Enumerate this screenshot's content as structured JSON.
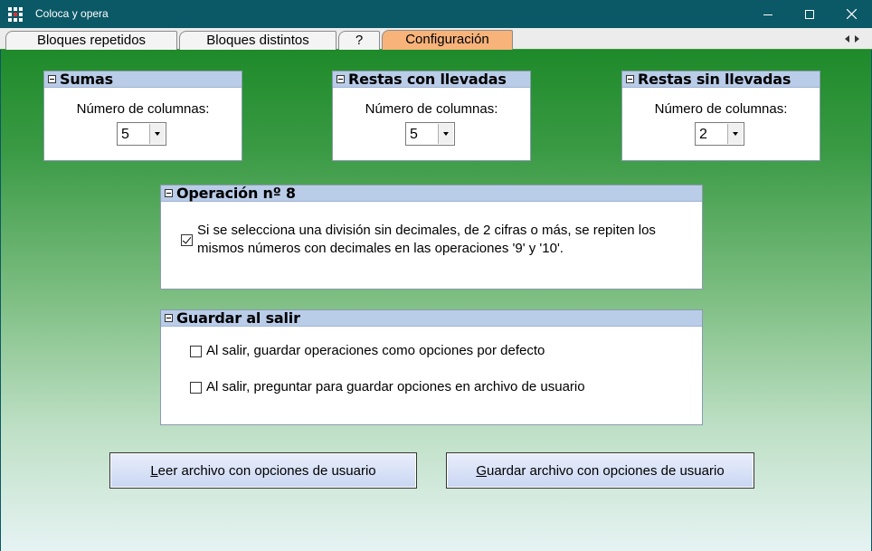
{
  "window": {
    "title": "Coloca y opera"
  },
  "tabs": [
    {
      "label": "Bloques repetidos"
    },
    {
      "label": "Bloques distintos"
    },
    {
      "label": "?"
    },
    {
      "label": "Configuración"
    }
  ],
  "panels": {
    "sumas": {
      "title": "Sumas",
      "label": "Número de columnas:",
      "value": "5"
    },
    "restas_con": {
      "title": "Restas con llevadas",
      "label": "Número de columnas:",
      "value": "5"
    },
    "restas_sin": {
      "title": "Restas sin llevadas",
      "label": "Número de columnas:",
      "value": "2"
    },
    "operacion": {
      "title": "Operación nº 8",
      "checkbox_line1": "Si se selecciona una división sin decimales, de 2 cifras o más, se repiten los",
      "checkbox_line2": "mismos números con decimales en las operaciones '9' y '10'."
    },
    "guardar": {
      "title": "Guardar al salir",
      "option1": "Al salir, guardar operaciones como opciones por defecto",
      "option2": "Al salir, preguntar para guardar opciones en archivo de usuario"
    }
  },
  "buttons": {
    "read_first": "L",
    "read_rest": "eer archivo con opciones de usuario",
    "save_first": "G",
    "save_rest": "uardar archivo con opciones de usuario"
  }
}
